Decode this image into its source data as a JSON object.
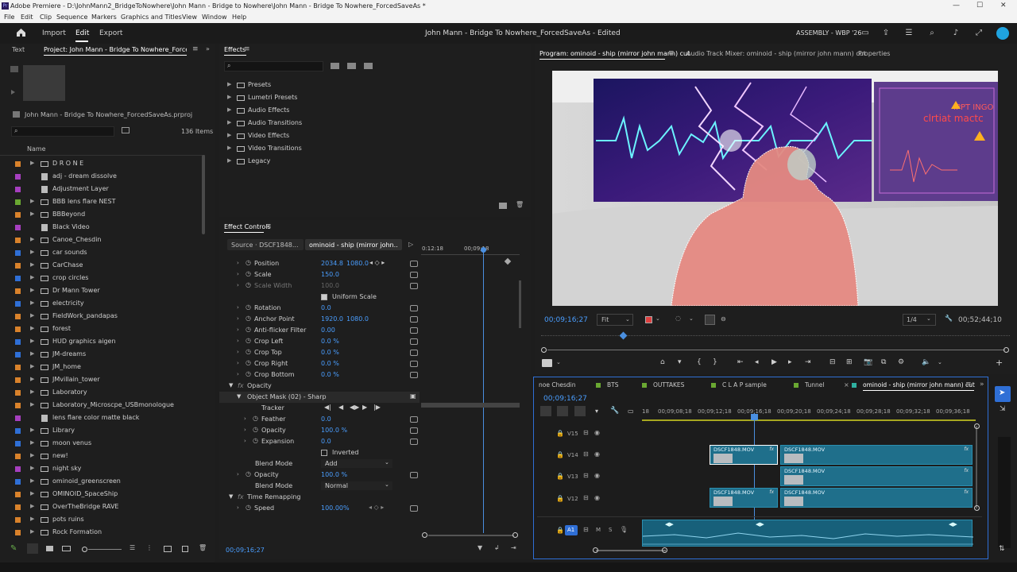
{
  "window": {
    "title": "Adobe Premiere - D:\\JohnMann2_BridgeToNowhere\\John Mann - Bridge to Nowhere\\John Mann - Bridge To Nowhere_ForcedSaveAs *",
    "app_icon": "Pr",
    "controls": {
      "minimize": "—",
      "maximize": "☐",
      "close": "✕"
    }
  },
  "menu": [
    "File",
    "Edit",
    "Clip",
    "Sequence",
    "Markers",
    "Graphics and Titles",
    "View",
    "Window",
    "Help"
  ],
  "header": {
    "home_icon": "home-icon",
    "nav": [
      {
        "label": "Import",
        "active": false
      },
      {
        "label": "Edit",
        "active": true
      },
      {
        "label": "Export",
        "active": false
      }
    ],
    "project_title": "John Mann - Bridge To Nowhere_ForcedSaveAs",
    "status": "- Edited",
    "workspace": "ASSEMBLY - WBP '26",
    "icons": [
      "workspaces-icon",
      "quick-export-icon",
      "panel-menu-icon",
      "search-icon",
      "audio-icon",
      "fullscreen-icon",
      "creative-cloud-icon"
    ]
  },
  "project": {
    "tabs": [
      {
        "label": "Text",
        "active": false
      },
      {
        "label": "Project: John Mann - Bridge To Nowhere_ForcedSaveAs",
        "active": true
      }
    ],
    "file_name": "John Mann - Bridge To Nowhere_ForcedSaveAs.prproj",
    "item_count": "136 Items",
    "search_placeholder": "",
    "column_header": "Name",
    "items": [
      {
        "label": "D R O N E",
        "color": "#d9822b",
        "type": "bin"
      },
      {
        "label": "adj - dream dissolve",
        "color": "#a63fbf",
        "type": "clip"
      },
      {
        "label": "Adjustment Layer",
        "color": "#a63fbf",
        "type": "clip"
      },
      {
        "label": "BBB lens flare NEST",
        "color": "#6aa832",
        "type": "bin"
      },
      {
        "label": "BBBeyond",
        "color": "#d9822b",
        "type": "bin"
      },
      {
        "label": "Black Video",
        "color": "#a63fbf",
        "type": "clip"
      },
      {
        "label": "Canoe_Chesdin",
        "color": "#d9822b",
        "type": "bin"
      },
      {
        "label": "car sounds",
        "color": "#2f6fd6",
        "type": "bin"
      },
      {
        "label": "CarChase",
        "color": "#d9822b",
        "type": "bin"
      },
      {
        "label": "crop circles",
        "color": "#2f6fd6",
        "type": "bin"
      },
      {
        "label": "Dr Mann Tower",
        "color": "#d9822b",
        "type": "bin"
      },
      {
        "label": "electricity",
        "color": "#2f6fd6",
        "type": "bin"
      },
      {
        "label": "FieldWork_pandapas",
        "color": "#d9822b",
        "type": "bin"
      },
      {
        "label": "forest",
        "color": "#d9822b",
        "type": "bin"
      },
      {
        "label": "HUD graphics aigen",
        "color": "#2f6fd6",
        "type": "bin"
      },
      {
        "label": "JM-dreams",
        "color": "#2f6fd6",
        "type": "bin"
      },
      {
        "label": "JM_home",
        "color": "#d9822b",
        "type": "bin"
      },
      {
        "label": "JMvillain_tower",
        "color": "#d9822b",
        "type": "bin"
      },
      {
        "label": "Laboratory",
        "color": "#d9822b",
        "type": "bin"
      },
      {
        "label": "Laboratory_Microscpe_USBmonologue",
        "color": "#d9822b",
        "type": "bin"
      },
      {
        "label": "lens flare color matte black",
        "color": "#a63fbf",
        "type": "clip"
      },
      {
        "label": "Library",
        "color": "#2f6fd6",
        "type": "bin"
      },
      {
        "label": "moon venus",
        "color": "#2f6fd6",
        "type": "bin"
      },
      {
        "label": "new!",
        "color": "#d9822b",
        "type": "bin"
      },
      {
        "label": "night sky",
        "color": "#a63fbf",
        "type": "bin"
      },
      {
        "label": "ominoid_greenscreen",
        "color": "#2f6fd6",
        "type": "bin"
      },
      {
        "label": "OMINOID_SpaceShip",
        "color": "#d9822b",
        "type": "bin"
      },
      {
        "label": "OverTheBridge RAVE",
        "color": "#d9822b",
        "type": "bin"
      },
      {
        "label": "pots ruins",
        "color": "#d9822b",
        "type": "bin"
      },
      {
        "label": "Rock Formation",
        "color": "#d9822b",
        "type": "bin"
      }
    ]
  },
  "effects": {
    "tab": "Effects",
    "search_placeholder": "",
    "items": [
      "Presets",
      "Lumetri Presets",
      "Audio Effects",
      "Audio Transitions",
      "Video Effects",
      "Video Transitions",
      "Legacy"
    ]
  },
  "effect_controls": {
    "tab": "Effect Controls",
    "source_label": "Source · DSCF1848...",
    "sequence_label": "ominoid - ship (mirror john...",
    "ruler_start": "0:12:18",
    "ruler_mid": "00;09;18",
    "timecode": "00;09;16;27",
    "rows": [
      {
        "label": "Position",
        "v1": "2034.8",
        "v2": "1080.0",
        "indent": 1
      },
      {
        "label": "Scale",
        "v1": "150.0",
        "v2": "",
        "indent": 1
      },
      {
        "label": "Scale Width",
        "v1": "100.0",
        "v2": "",
        "indent": 1,
        "dim": true
      },
      {
        "label": "Uniform Scale",
        "checkbox": true,
        "checked": true
      },
      {
        "label": "Rotation",
        "v1": "0.0",
        "v2": "",
        "indent": 1
      },
      {
        "label": "Anchor Point",
        "v1": "1920.0",
        "v2": "1080.0",
        "indent": 1
      },
      {
        "label": "Anti-flicker Filter",
        "v1": "0.00",
        "v2": "",
        "indent": 1
      },
      {
        "label": "Crop Left",
        "v1": "0.0 %",
        "v2": "",
        "indent": 1
      },
      {
        "label": "Crop Top",
        "v1": "0.0 %",
        "v2": "",
        "indent": 1
      },
      {
        "label": "Crop Right",
        "v1": "0.0 %",
        "v2": "",
        "indent": 1
      },
      {
        "label": "Crop Bottom",
        "v1": "0.0 %",
        "v2": "",
        "indent": 1
      },
      {
        "label": "Opacity",
        "section": true
      },
      {
        "label": "Object Mask (02) - Sharp",
        "mask": true
      },
      {
        "label": "Tracker",
        "tracker": true
      },
      {
        "label": "Feather",
        "v1": "0.0",
        "v2": "",
        "indent": 2
      },
      {
        "label": "Opacity",
        "v1": "100.0 %",
        "v2": "",
        "indent": 2
      },
      {
        "label": "Expansion",
        "v1": "0.0",
        "v2": "",
        "indent": 2
      },
      {
        "label": "Inverted",
        "checkbox": true,
        "checked": false
      },
      {
        "label": "Blend Mode",
        "select": "Add"
      },
      {
        "label": "Opacity",
        "v1": "100.0 %",
        "v2": "",
        "indent": 1
      },
      {
        "label": "Blend Mode",
        "select": "Normal"
      },
      {
        "label": "Time Remapping",
        "section": true
      },
      {
        "label": "Speed",
        "v1": "100.00%",
        "v2": "",
        "indent": 1
      }
    ]
  },
  "program": {
    "tabs": [
      {
        "label": "Program: ominoid - ship (mirror john mann) cut",
        "active": true
      },
      {
        "label": "Audio Track Mixer: ominoid - ship (mirror john mann) cut",
        "active": false
      },
      {
        "label": "Properties",
        "active": false
      }
    ],
    "timecode": "00;09;16;27",
    "fit": "Fit",
    "resolution": "1/4",
    "duration": "00;52;44;10",
    "overlay_text_1": "IPPT INGO",
    "overlay_text_2": "clrtiat mactc"
  },
  "timeline": {
    "tabs": [
      "noe Chesdin",
      "BTS",
      "OUTTAKES",
      "C L A P sample",
      "Tunnel",
      "ominoid - ship (mirror john mann) cut"
    ],
    "tab_colors": [
      "#2f6fd6",
      "#6aa832",
      "#6aa832",
      "#6aa832",
      "#6aa832",
      "#2fb0a0"
    ],
    "timecode": "00;09;16;27",
    "ruler": [
      "18",
      "00;09;08;18",
      "00;09;12;18",
      "00;09;16;18",
      "00;09;20;18",
      "00;09;24;18",
      "00;09;28;18",
      "00;09;32;18",
      "00;09;36;18"
    ],
    "tracks": [
      "V15",
      "V14",
      "V13",
      "V12",
      "A1"
    ],
    "clip_name": "DSCF1848.MOV",
    "audio_labels": {
      "m": "M",
      "s": "S"
    }
  }
}
